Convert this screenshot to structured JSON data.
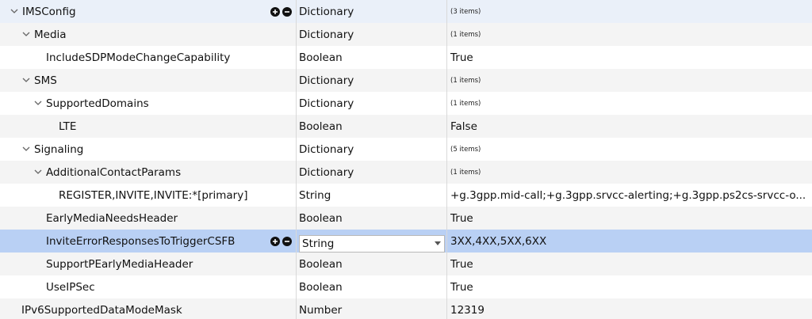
{
  "rows": [
    {
      "key": "IMSConfig",
      "type": "Dictionary",
      "value": "(3 items)",
      "small": true
    },
    {
      "key": "Media",
      "type": "Dictionary",
      "value": "(1 items)",
      "small": true
    },
    {
      "key": "IncludeSDPModeChangeCapability",
      "type": "Boolean",
      "value": "True"
    },
    {
      "key": "SMS",
      "type": "Dictionary",
      "value": "(1 items)",
      "small": true
    },
    {
      "key": "SupportedDomains",
      "type": "Dictionary",
      "value": "(1 items)",
      "small": true
    },
    {
      "key": "LTE",
      "type": "Boolean",
      "value": "False"
    },
    {
      "key": "Signaling",
      "type": "Dictionary",
      "value": "(5 items)",
      "small": true
    },
    {
      "key": "AdditionalContactParams",
      "type": "Dictionary",
      "value": "(1 items)",
      "small": true
    },
    {
      "key": "REGISTER,INVITE,INVITE:*[primary]",
      "type": "String",
      "value": "+g.3gpp.mid-call;+g.3gpp.srvcc-alerting;+g.3gpp.ps2cs-srvcc-o..."
    },
    {
      "key": "EarlyMediaNeedsHeader",
      "type": "Boolean",
      "value": "True"
    },
    {
      "key": "InviteErrorResponsesToTriggerCSFB",
      "type": "String",
      "value": "3XX,4XX,5XX,6XX"
    },
    {
      "key": "SupportPEarlyMediaHeader",
      "type": "Boolean",
      "value": "True"
    },
    {
      "key": "UseIPSec",
      "type": "Boolean",
      "value": "True"
    },
    {
      "key": "IPv6SupportedDataModeMask",
      "type": "Number",
      "value": "12319"
    }
  ],
  "icons": {
    "add": "plus-circle-icon",
    "remove": "minus-circle-icon",
    "expanded": "chevron-down-icon"
  },
  "colors": {
    "selected_row": "#b9d0f4",
    "top_row": "#eaf0f9",
    "alt_row": "#f4f4f4"
  }
}
